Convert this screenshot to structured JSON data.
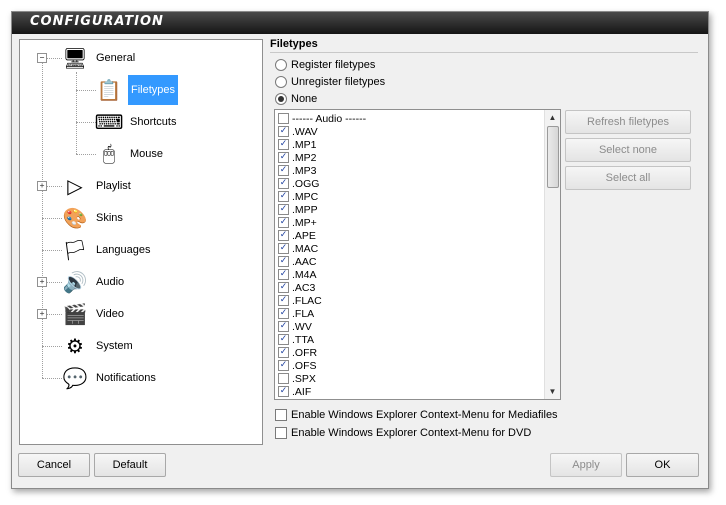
{
  "window": {
    "title": "CONFIGURATION"
  },
  "tree": {
    "items": [
      {
        "label": "General",
        "icon": "monitor-icon"
      },
      {
        "label": "Filetypes",
        "icon": "list-document-icon"
      },
      {
        "label": "Shortcuts",
        "icon": "keyboard-key-icon"
      },
      {
        "label": "Mouse",
        "icon": "mouse-icon"
      },
      {
        "label": "Playlist",
        "icon": "playlist-icon"
      },
      {
        "label": "Skins",
        "icon": "skin-icon"
      },
      {
        "label": "Languages",
        "icon": "flags-icon"
      },
      {
        "label": "Audio",
        "icon": "speaker-icon"
      },
      {
        "label": "Video",
        "icon": "clapperboard-icon"
      },
      {
        "label": "System",
        "icon": "gear-icon"
      },
      {
        "label": "Notifications",
        "icon": "speech-bubble-icon"
      }
    ],
    "selected": "Filetypes"
  },
  "panel": {
    "title": "Filetypes",
    "radios": [
      {
        "label": "Register filetypes",
        "checked": false
      },
      {
        "label": "Unregister filetypes",
        "checked": false
      },
      {
        "label": "None",
        "checked": true
      }
    ],
    "list": [
      {
        "label": "------ Audio ------",
        "checked": false
      },
      {
        "label": ".WAV",
        "checked": true
      },
      {
        "label": ".MP1",
        "checked": true
      },
      {
        "label": ".MP2",
        "checked": true
      },
      {
        "label": ".MP3",
        "checked": true
      },
      {
        "label": ".OGG",
        "checked": true
      },
      {
        "label": ".MPC",
        "checked": true
      },
      {
        "label": ".MPP",
        "checked": true
      },
      {
        "label": ".MP+",
        "checked": true
      },
      {
        "label": ".APE",
        "checked": true
      },
      {
        "label": ".MAC",
        "checked": true
      },
      {
        "label": ".AAC",
        "checked": true
      },
      {
        "label": ".M4A",
        "checked": true
      },
      {
        "label": ".AC3",
        "checked": true
      },
      {
        "label": ".FLAC",
        "checked": true
      },
      {
        "label": ".FLA",
        "checked": true
      },
      {
        "label": ".WV",
        "checked": true
      },
      {
        "label": ".TTA",
        "checked": true
      },
      {
        "label": ".OFR",
        "checked": true
      },
      {
        "label": ".OFS",
        "checked": true
      },
      {
        "label": ".SPX",
        "checked": false
      },
      {
        "label": ".AIF",
        "checked": true
      }
    ],
    "side_buttons": {
      "refresh": "Refresh filetypes",
      "select_none": "Select none",
      "select_all": "Select all"
    },
    "options": [
      {
        "label": "Enable Windows Explorer Context-Menu for Mediafiles",
        "checked": false
      },
      {
        "label": "Enable Windows Explorer Context-Menu for DVD",
        "checked": false
      }
    ]
  },
  "footer": {
    "cancel": "Cancel",
    "default": "Default",
    "apply": "Apply",
    "ok": "OK"
  }
}
